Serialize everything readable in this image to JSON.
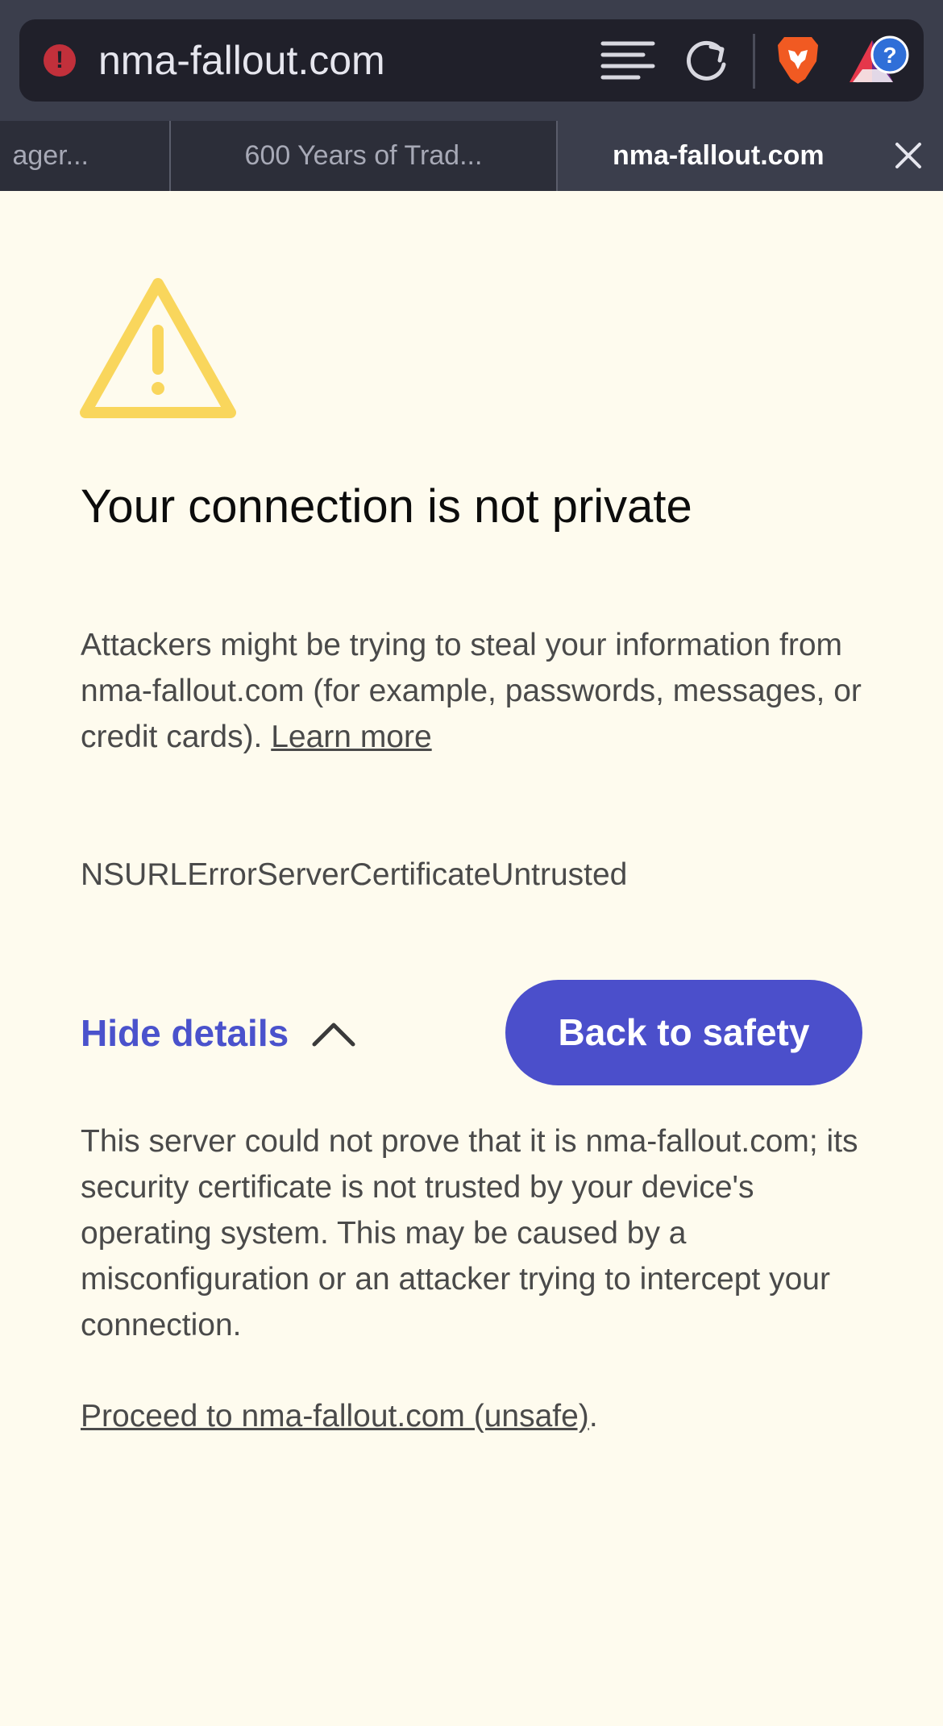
{
  "address_bar": {
    "url": "nma-fallout.com"
  },
  "tabs": [
    {
      "label": "ager..."
    },
    {
      "label": "600 Years of Trad..."
    },
    {
      "label": "nma-fallout.com",
      "active": true
    }
  ],
  "icons": {
    "security_warning": "exclamation-circle-icon",
    "menu": "reader-menu-icon",
    "reload": "reload-icon",
    "brave": "brave-lion-icon",
    "rewards": "brave-rewards-icon",
    "tab_close": "close-icon",
    "warning": "warning-triangle-icon",
    "chevron": "chevron-up-icon"
  },
  "colors": {
    "accent": "#4b4fcb",
    "warning_yellow": "#f9d65c",
    "background": "#fefbee",
    "chrome": "#3b3e4c"
  },
  "main": {
    "title": "Your connection is not private",
    "description": "Attackers might be trying to steal your information from nma-fallout.com (for example, passwords, messages, or credit cards). ",
    "learn_more": "Learn more",
    "error_code": "NSURLErrorServerCertificateUntrusted",
    "hide_details": "Hide details",
    "back_button": "Back to safety",
    "details": "This server could not prove that it is nma-fallout.com; its security certificate is not trusted by your device's operating system. This may be caused by a misconfiguration or an attacker trying to intercept your connection.",
    "proceed_link": "Proceed to nma-fallout.com (unsafe)",
    "proceed_suffix": "."
  }
}
